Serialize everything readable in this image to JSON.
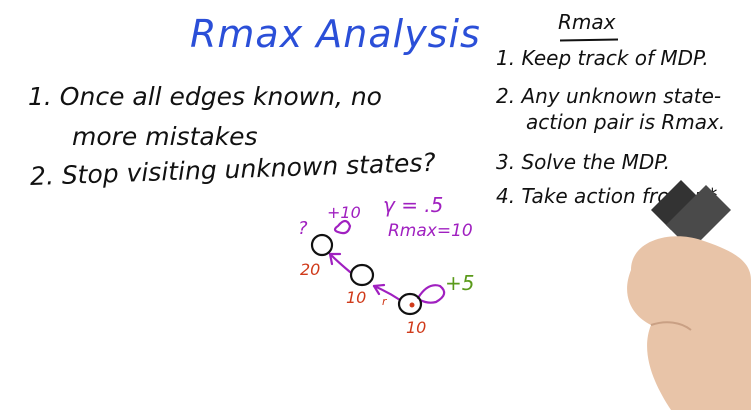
{
  "title": "Rmax Analysis",
  "main_points": {
    "p1_line1": "1. Once all edges known, no",
    "p1_line2": "more mistakes",
    "p2": "2. Stop visiting unknown states?"
  },
  "rmax_box": {
    "heading": "Rmax",
    "s1": "1. Keep track of MDP.",
    "s2_line1": "2. Any unknown state-",
    "s2_line2": "action pair is Rmax.",
    "s3": "3. Solve the MDP.",
    "s4": "4. Take action from π*."
  },
  "diagram": {
    "gamma": "γ = .5",
    "rmax_value": "Rmax=10",
    "top_reward": "+10",
    "question": "?",
    "right_reward": "+5",
    "node_values": [
      "20",
      "10",
      "10"
    ],
    "edge_mark": "r",
    "colors": {
      "annotation": "#a020c0",
      "values": "#d03a1a",
      "reward": "#5a9a1a",
      "title": "#2b4fd8"
    }
  }
}
